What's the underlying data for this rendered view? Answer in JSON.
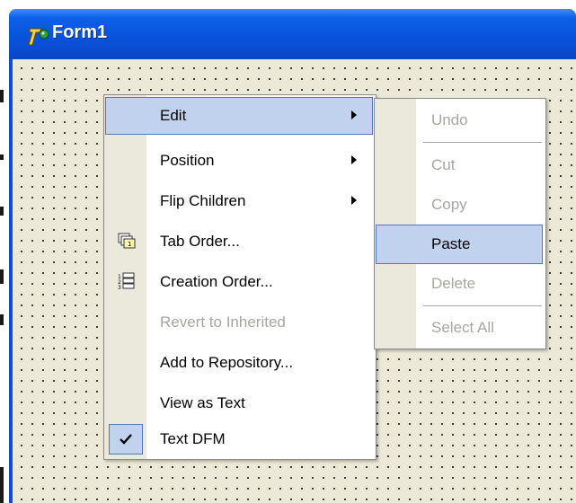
{
  "window": {
    "title": "Form1",
    "colors": {
      "titlebar": "#0a52db",
      "client": "#ece9d8",
      "highlight": "#c1d2ee",
      "highlight_border": "#5278bd",
      "disabled_text": "#a7a6a0"
    }
  },
  "context_menu": {
    "items": [
      {
        "label": "Edit",
        "submenu": true,
        "highlighted": true,
        "enabled": true
      },
      {
        "label": "Position",
        "submenu": true,
        "enabled": true
      },
      {
        "label": "Flip Children",
        "submenu": true,
        "enabled": true
      },
      {
        "label": "Tab Order...",
        "icon": "tab-order-icon",
        "enabled": true
      },
      {
        "label": "Creation Order...",
        "icon": "creation-order-icon",
        "enabled": true
      },
      {
        "label": "Revert to Inherited",
        "enabled": false
      },
      {
        "label": "Add to Repository...",
        "enabled": true
      },
      {
        "label": "View as Text",
        "enabled": true
      },
      {
        "label": "Text DFM",
        "checked": true,
        "icon": "checkmark-icon",
        "enabled": true
      }
    ]
  },
  "edit_submenu": {
    "items": [
      {
        "label": "Undo",
        "enabled": false
      },
      {
        "label": "Cut",
        "enabled": false
      },
      {
        "label": "Copy",
        "enabled": false
      },
      {
        "label": "Paste",
        "enabled": true,
        "highlighted": true
      },
      {
        "label": "Delete",
        "enabled": false
      },
      {
        "label": "Select All",
        "enabled": false
      }
    ]
  }
}
